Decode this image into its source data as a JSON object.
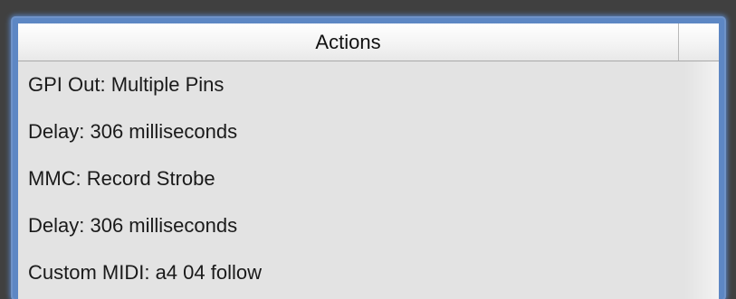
{
  "table": {
    "column_header": "Actions",
    "rows": [
      {
        "label": "GPI Out: Multiple Pins"
      },
      {
        "label": "Delay: 306 milliseconds"
      },
      {
        "label": "MMC: Record Strobe"
      },
      {
        "label": "Delay: 306 milliseconds"
      },
      {
        "label": "Custom MIDI: a4 04 follow"
      }
    ]
  },
  "colors": {
    "focus_ring": "#5d87c4",
    "table_background": "#e3e3e3",
    "window_background": "#404040"
  }
}
